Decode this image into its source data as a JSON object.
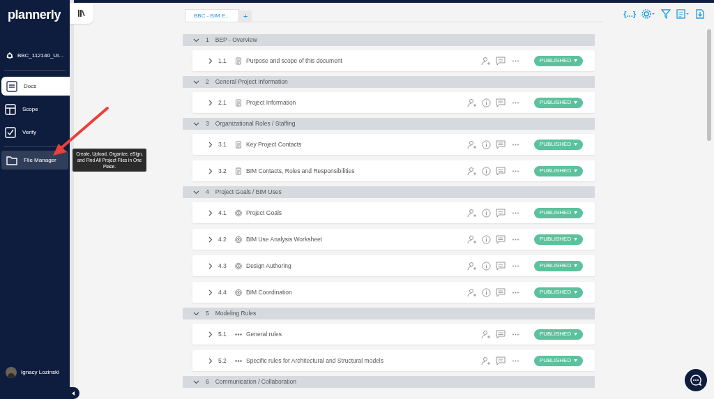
{
  "sidebar": {
    "logo": "plannerly",
    "project": "BBC_112140_UI...",
    "nav": [
      {
        "label": "Docs",
        "selected": true
      },
      {
        "label": "Scope",
        "selected": false
      },
      {
        "label": "Verify",
        "selected": false
      },
      {
        "label": "File Manager",
        "selected": false
      }
    ],
    "tooltip": "Create, Upload, Organize, eSign, and Find All Project Files in One Place.",
    "user": "Ignacy Lozinski"
  },
  "tabs": [
    {
      "label": "BBC - BIM E...",
      "selected": true
    },
    {
      "label": "+",
      "selected": false
    }
  ],
  "toolbar": {
    "variables": "{...}"
  },
  "sections": [
    {
      "number": "1",
      "title": "BEP - Overview",
      "expanded": true,
      "items": [
        {
          "number": "1.1",
          "kind": "doc",
          "title": "Purpose and scope of this document",
          "info": false,
          "status": "PUBLISHED"
        }
      ]
    },
    {
      "number": "2",
      "title": "General Project Information",
      "expanded": true,
      "items": [
        {
          "number": "2.1",
          "kind": "doc",
          "title": "Project Information",
          "info": true,
          "status": "PUBLISHED"
        }
      ]
    },
    {
      "number": "3",
      "title": "Organizational Roles / Staffing",
      "expanded": true,
      "items": [
        {
          "number": "3.1",
          "kind": "doc",
          "title": "Key Project Contacts",
          "info": true,
          "status": "PUBLISHED"
        },
        {
          "number": "3.2",
          "kind": "doc",
          "title": "BIM Contacts, Roles and Responsibilities",
          "info": true,
          "status": "PUBLISHED"
        }
      ]
    },
    {
      "number": "4",
      "title": "Project Goals / BIM Uses",
      "expanded": true,
      "items": [
        {
          "number": "4.1",
          "kind": "target",
          "title": "Project Goals",
          "info": true,
          "status": "PUBLISHED"
        },
        {
          "number": "4.2",
          "kind": "target",
          "title": "BIM Use Analysis Worksheet",
          "info": true,
          "status": "PUBLISHED"
        },
        {
          "number": "4.3",
          "kind": "target",
          "title": "Design Authoring",
          "info": true,
          "status": "PUBLISHED"
        },
        {
          "number": "4.4",
          "kind": "target",
          "title": "BIM Coordination",
          "info": true,
          "status": "PUBLISHED"
        }
      ]
    },
    {
      "number": "5",
      "title": "Modeling Rules",
      "expanded": true,
      "items": [
        {
          "number": "5.1",
          "kind": "dots",
          "title": "General rules",
          "info": false,
          "status": "PUBLISHED"
        },
        {
          "number": "5.2",
          "kind": "dots",
          "title": "Specific rules for Architectural and Structural models",
          "info": false,
          "status": "PUBLISHED"
        }
      ]
    },
    {
      "number": "6",
      "title": "Communication / Collaboration",
      "expanded": true
    }
  ]
}
